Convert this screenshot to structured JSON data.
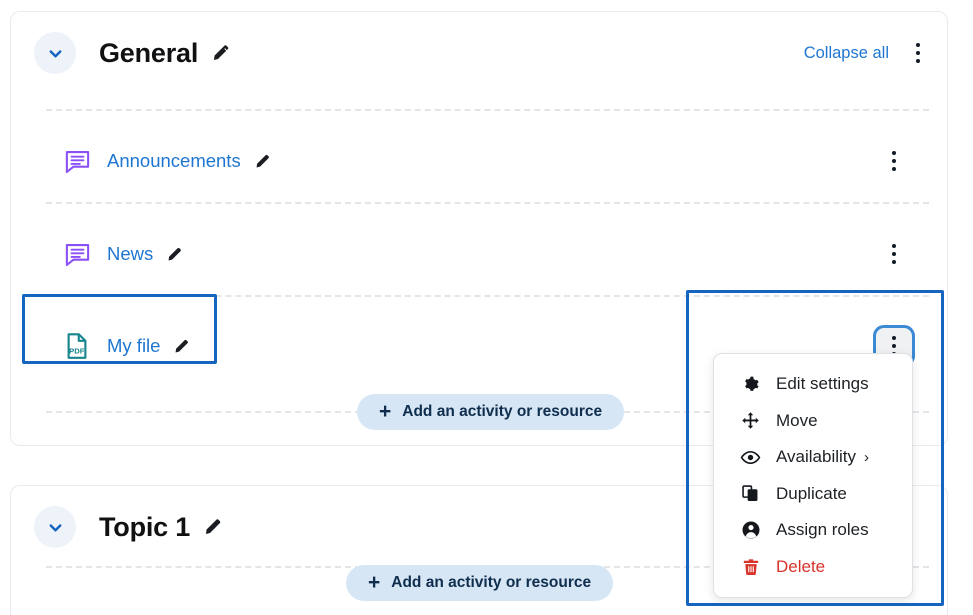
{
  "theme": {
    "link_blue": "#1e76d2",
    "highlight_blue": "#1565c0",
    "forum_icon_purple": "#8a4ff7",
    "pdf_icon_teal": "#17858d",
    "danger_red": "#d9342b",
    "add_button_bg": "#d6e6f5",
    "add_button_text": "#0f2d4d"
  },
  "sections": [
    {
      "title": "General",
      "collapse_all_label": "Collapse all",
      "edit_title_icon": "pencil-icon",
      "collapse_icon": "chevron-down-icon",
      "kebab_icon": "kebab-menu-icon",
      "activities": [
        {
          "name": "Announcements",
          "icon": "forum-icon",
          "edit_icon": "pencil-icon",
          "kebab_icon": "kebab-menu-icon"
        },
        {
          "name": "News",
          "icon": "forum-icon",
          "edit_icon": "pencil-icon",
          "kebab_icon": "kebab-menu-icon"
        },
        {
          "name": "My file",
          "icon": "pdf-file-icon",
          "icon_label": "PDF",
          "edit_icon": "pencil-icon",
          "kebab_icon": "kebab-menu-icon",
          "highlighted": true
        }
      ],
      "add_activity_label": "Add an activity or resource",
      "add_activity_icon": "plus-icon"
    },
    {
      "title": "Topic 1",
      "edit_title_icon": "pencil-icon",
      "collapse_icon": "chevron-down-icon",
      "kebab_icon": "kebab-menu-icon",
      "activities": [],
      "add_activity_label": "Add an activity or resource",
      "add_activity_icon": "plus-icon"
    }
  ],
  "action_menu": {
    "open": true,
    "owner": "my-file-activity",
    "items": [
      {
        "label": "Edit settings",
        "icon": "gear-icon",
        "has_submenu": false,
        "danger": false
      },
      {
        "label": "Move",
        "icon": "move-arrows-icon",
        "has_submenu": false,
        "danger": false
      },
      {
        "label": "Availability",
        "icon": "eye-icon",
        "has_submenu": true,
        "submenu_icon": "chevron-right-icon",
        "danger": false
      },
      {
        "label": "Duplicate",
        "icon": "duplicate-icon",
        "has_submenu": false,
        "danger": false
      },
      {
        "label": "Assign roles",
        "icon": "user-circle-icon",
        "has_submenu": false,
        "danger": false
      },
      {
        "label": "Delete",
        "icon": "trash-icon",
        "has_submenu": false,
        "danger": true
      }
    ]
  }
}
